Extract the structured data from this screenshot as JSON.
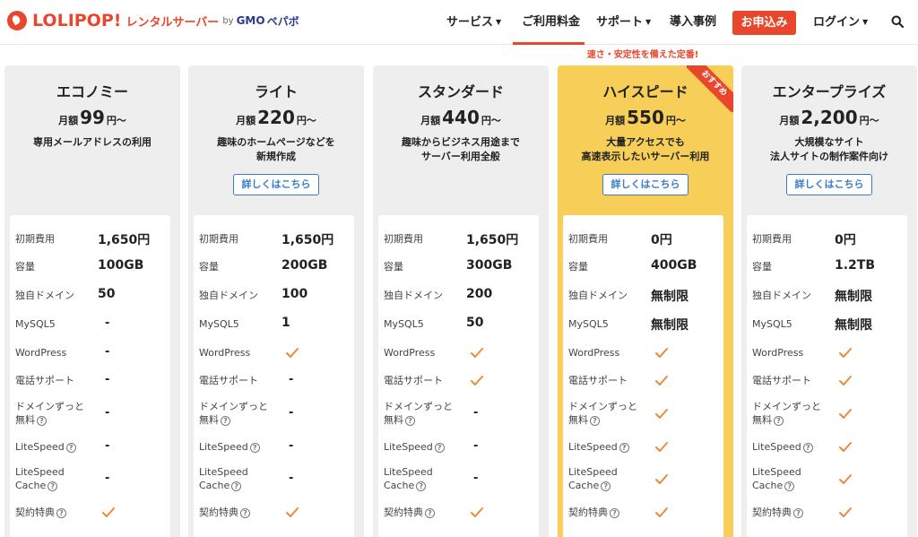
{
  "header": {
    "logo": {
      "brand": "LOLIPOP!",
      "sub": "レンタルサーバー",
      "by": "by",
      "gmo": "GMO",
      "pepabo": "ペパボ"
    },
    "nav": [
      {
        "label": "サービス",
        "caret": true
      },
      {
        "label": "ご利用料金",
        "caret": false,
        "active": true
      },
      {
        "label": "サポート",
        "caret": true
      },
      {
        "label": "導入事例",
        "caret": false
      }
    ],
    "apply_label": "お申込み",
    "login_label": "ログイン",
    "accent_color": "#e8472d"
  },
  "tagline": "速さ・安定性を備えた定番!",
  "row_labels": {
    "initial": "初期費用",
    "capacity": "容量",
    "domain": "独自ドメイン",
    "mysql": "MySQL5",
    "wordpress": "WordPress",
    "phone": "電話サポート",
    "domain_free_1": "ドメインずっと",
    "domain_free_2": "無料",
    "litespeed": "LiteSpeed",
    "litespeed_cache_1": "LiteSpeed",
    "litespeed_cache_2": "Cache",
    "benefit": "契約特典"
  },
  "plans": [
    {
      "name": "エコノミー",
      "price_prefix": "月額",
      "price": "99",
      "price_suffix": "円〜",
      "desc_1": "専用メールアドレスの利用",
      "desc_2": "",
      "detail_label": "",
      "specs": {
        "initial": "1,650円",
        "capacity": "100GB",
        "domain": "50",
        "mysql": "-",
        "wordpress": "-",
        "phone": "-",
        "domain_free": "-",
        "litespeed": "-",
        "litespeed_cache": "-",
        "benefit": "check"
      }
    },
    {
      "name": "ライト",
      "price_prefix": "月額",
      "price": "220",
      "price_suffix": "円〜",
      "desc_1": "趣味のホームページなどを",
      "desc_2": "新規作成",
      "detail_label": "詳しくはこちら",
      "specs": {
        "initial": "1,650円",
        "capacity": "200GB",
        "domain": "100",
        "mysql": "1",
        "wordpress": "check",
        "phone": "-",
        "domain_free": "-",
        "litespeed": "-",
        "litespeed_cache": "-",
        "benefit": "check"
      }
    },
    {
      "name": "スタンダード",
      "price_prefix": "月額",
      "price": "440",
      "price_suffix": "円〜",
      "desc_1": "趣味からビジネス用途まで",
      "desc_2": "サーバー利用全般",
      "detail_label": "",
      "specs": {
        "initial": "1,650円",
        "capacity": "300GB",
        "domain": "200",
        "mysql": "50",
        "wordpress": "check",
        "phone": "check",
        "domain_free": "-",
        "litespeed": "-",
        "litespeed_cache": "-",
        "benefit": "check"
      }
    },
    {
      "name": "ハイスピード",
      "price_prefix": "月額",
      "price": "550",
      "price_suffix": "円〜",
      "desc_1": "大量アクセスでも",
      "desc_2": "高速表示したいサーバー利用",
      "detail_label": "詳しくはこちら",
      "ribbon": "おすすめ",
      "highlight_color": "#f7cf58",
      "specs": {
        "initial": "0円",
        "capacity": "400GB",
        "domain": "無制限",
        "mysql": "無制限",
        "wordpress": "check",
        "phone": "check",
        "domain_free": "check",
        "litespeed": "check",
        "litespeed_cache": "check",
        "benefit": "check"
      }
    },
    {
      "name": "エンタープライズ",
      "price_prefix": "月額",
      "price": "2,200",
      "price_suffix": "円〜",
      "desc_1": "大規模なサイト",
      "desc_2": "法人サイトの制作案件向け",
      "detail_label": "詳しくはこちら",
      "specs": {
        "initial": "0円",
        "capacity": "1.2TB",
        "domain": "無制限",
        "mysql": "無制限",
        "wordpress": "check",
        "phone": "check",
        "domain_free": "check",
        "litespeed": "check",
        "litespeed_cache": "check",
        "benefit": "check"
      }
    }
  ]
}
